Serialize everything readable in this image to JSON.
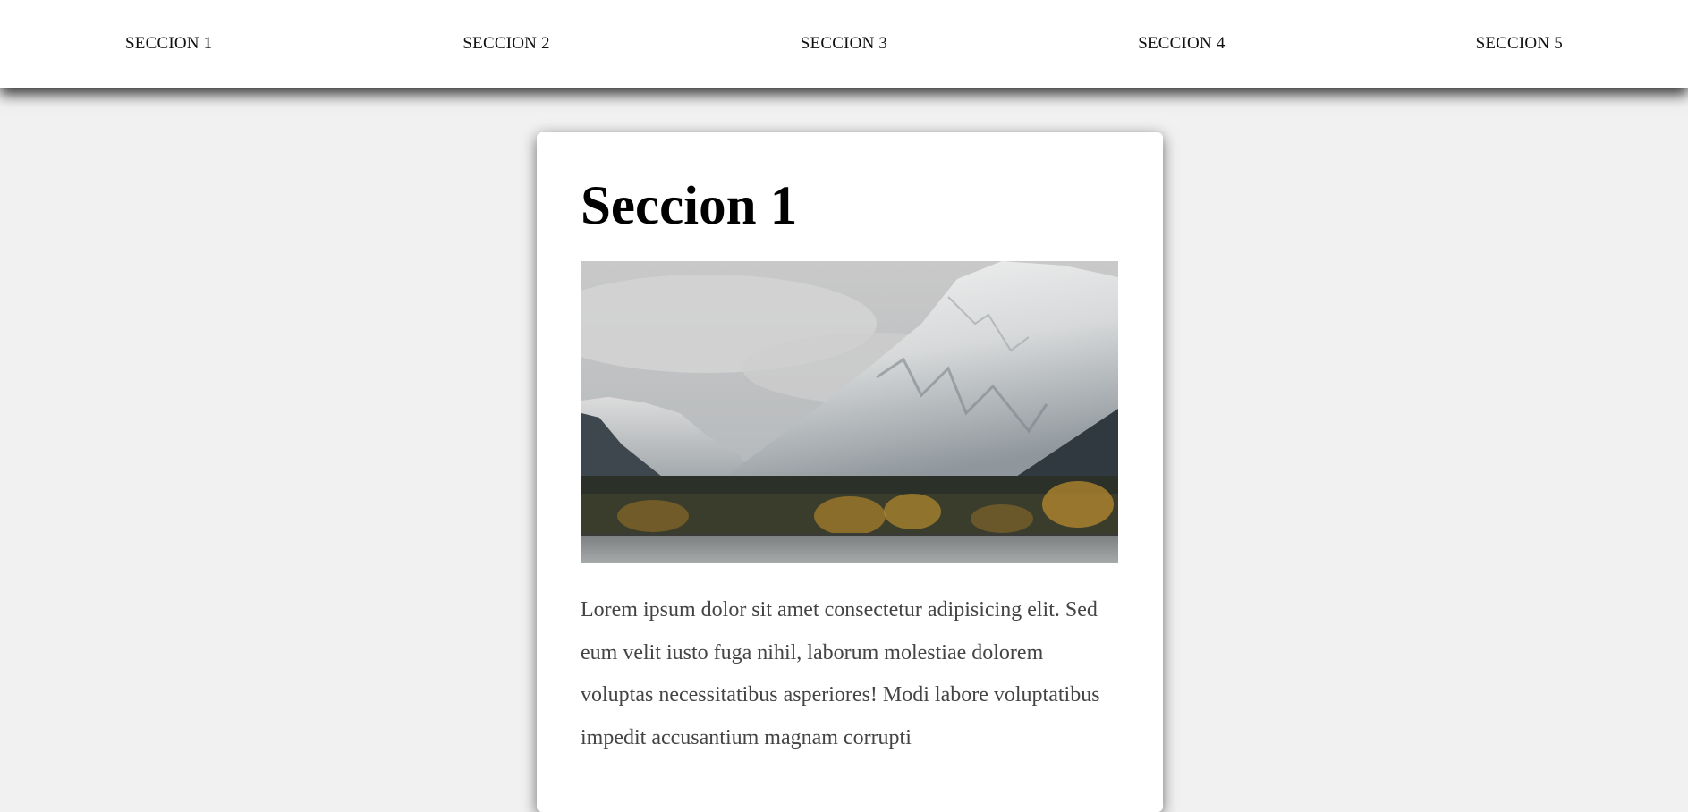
{
  "nav": {
    "items": [
      {
        "label": "SECCION 1"
      },
      {
        "label": "SECCION 2"
      },
      {
        "label": "SECCION 3"
      },
      {
        "label": "SECCION 4"
      },
      {
        "label": "SECCION 5"
      }
    ]
  },
  "section": {
    "title": "Seccion 1",
    "body": "Lorem ipsum dolor sit amet consectetur adipisicing elit. Sed eum velit iusto fuga nihil, laborum molestiae dolorem voluptas necessitatibus asperiores! Modi labore voluptatibus impedit accusantium magnam corrupti"
  },
  "colors": {
    "page_background": "#f1f1f1",
    "nav_background": "#ffffff",
    "card_background": "#ffffff",
    "title_text": "#000000",
    "body_text": "#444444"
  }
}
